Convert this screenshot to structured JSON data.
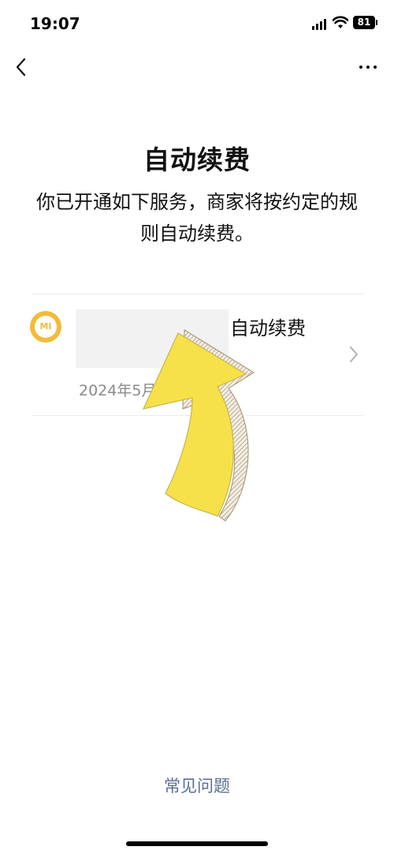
{
  "status_bar": {
    "time": "19:07",
    "battery": "81"
  },
  "nav": {
    "back_icon": "chevron-left-icon",
    "more_icon": "more-horizontal-icon"
  },
  "page": {
    "title": "自动续费",
    "description": "你已开通如下服务，商家将按约定的规则自动续费。"
  },
  "subscription": {
    "logo_text": "MI",
    "logo_color": "#f2bb3a",
    "name_suffix": "自动续费",
    "date_text": "2024年5月 开通服务"
  },
  "footer": {
    "faq_label": "常见问题",
    "faq_color": "#5a6e94"
  },
  "overlay": {
    "arrow_color": "#f7e14a"
  }
}
